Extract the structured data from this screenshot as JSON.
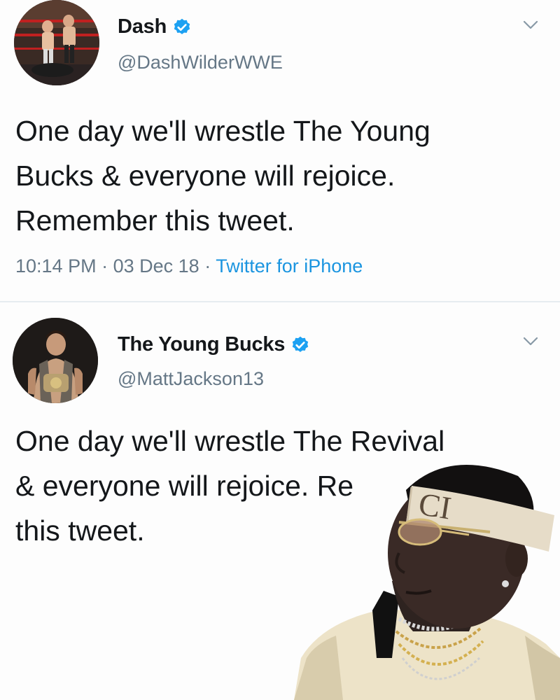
{
  "tweets": [
    {
      "display_name": "Dash",
      "handle": "@DashWilderWWE",
      "verified": true,
      "text_lines": [
        "One day we'll wrestle The Young",
        "Bucks & everyone will rejoice.",
        "Remember this tweet."
      ],
      "time": "10:14 PM",
      "separator": "·",
      "date": "03 Dec 18",
      "source": "Twitter for iPhone",
      "avatar_icon": "wrestlers-photo-avatar"
    },
    {
      "display_name": "The Young Bucks",
      "handle": "@MattJackson13",
      "verified": true,
      "text_lines": [
        "One day we'll wrestle The Revival",
        "& everyone will rejoice. Re",
        "this tweet."
      ],
      "avatar_icon": "wrestler-with-belt-avatar"
    }
  ],
  "overlay": {
    "headband_text": "CI"
  },
  "colors": {
    "verified_blue": "#1da1f2",
    "link_blue": "#1b95e0",
    "text_dark": "#14171a",
    "text_gray": "#657786",
    "divider": "#e6ecf0"
  }
}
